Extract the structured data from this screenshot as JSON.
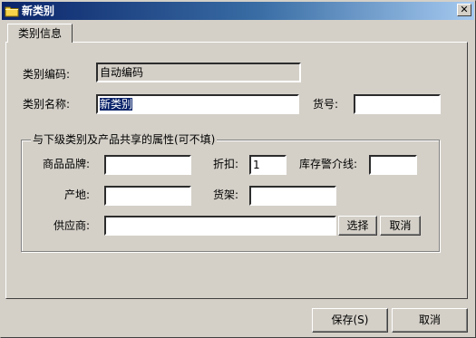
{
  "window": {
    "title": "新类别",
    "close_glyph": "✕"
  },
  "tab": {
    "label": "类别信息"
  },
  "form": {
    "code_label": "类别编码:",
    "code_value": "自动编码",
    "name_label": "类别名称:",
    "name_value": "新类别",
    "number_label": "货号:",
    "number_value": ""
  },
  "group": {
    "legend": "与下级类别及产品共享的属性(可不填)",
    "brand_label": "商品品牌:",
    "brand_value": "",
    "discount_label": "折扣:",
    "discount_value": "1",
    "stock_warn_label": "库存警介线:",
    "stock_warn_value": "",
    "origin_label": "产地:",
    "origin_value": "",
    "shelf_label": "货架:",
    "shelf_value": "",
    "supplier_label": "供应商:",
    "supplier_value": "",
    "select_button": "选择",
    "cancel_button": "取消"
  },
  "footer": {
    "save_button": "保存(S)",
    "cancel_button": "取消"
  },
  "colors": {
    "titlebar_start": "#0a246a",
    "titlebar_end": "#a6caf0",
    "face": "#d4d0c8",
    "selection": "#0a246a"
  }
}
